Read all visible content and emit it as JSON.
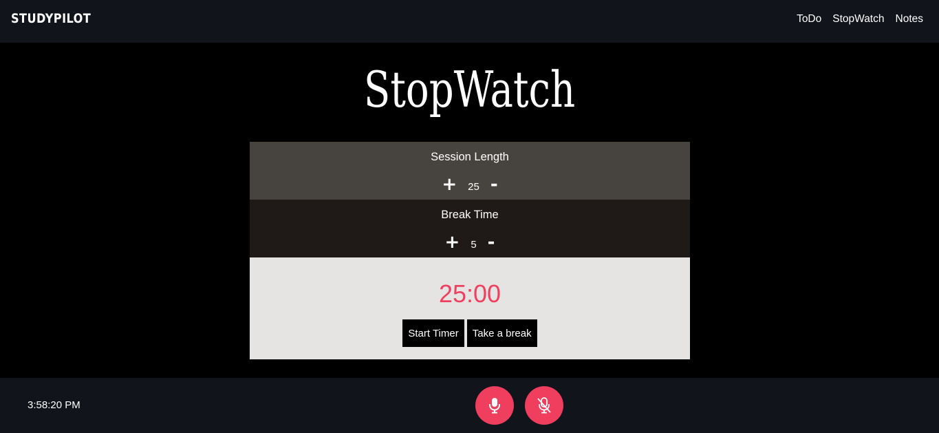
{
  "app": {
    "brand": "STUDYPILOT"
  },
  "nav": {
    "items": [
      {
        "label": "ToDo"
      },
      {
        "label": "StopWatch"
      },
      {
        "label": "Notes"
      }
    ]
  },
  "main": {
    "title": "StopWatch",
    "session": {
      "label": "Session Length",
      "value": "25",
      "increment": "+",
      "decrement": "-"
    },
    "break": {
      "label": "Break Time",
      "value": "5",
      "increment": "+",
      "decrement": "-"
    },
    "timer": {
      "display": "25:00",
      "start_label": "Start Timer",
      "break_label": "Take a break"
    }
  },
  "footer": {
    "clock": "3:58:20 PM",
    "mic_on_icon": "microphone-icon",
    "mic_off_icon": "microphone-off-icon"
  },
  "colors": {
    "accent": "#f03e5f",
    "session_bg": "#47433f",
    "break_bg": "#1f1a17",
    "timer_bg": "#e6e4e2",
    "bar_bg": "#11141a"
  }
}
